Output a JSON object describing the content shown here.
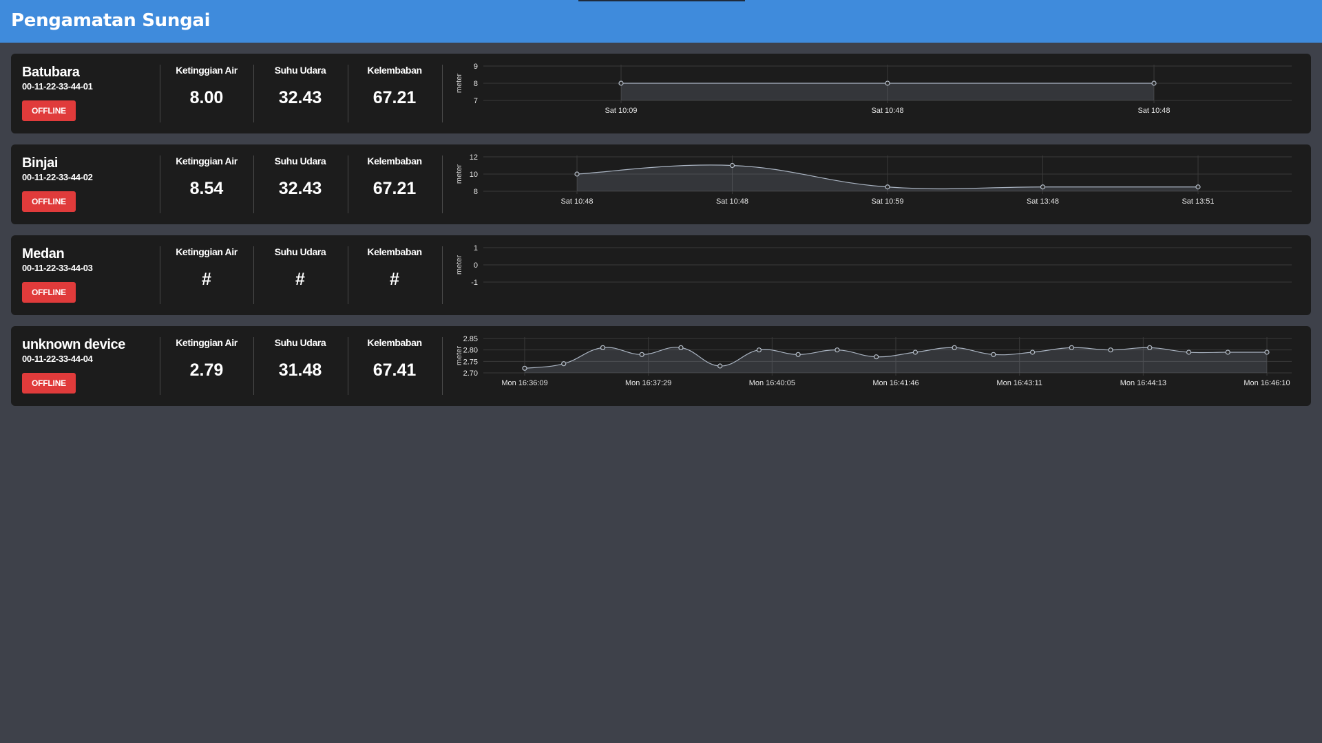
{
  "header": {
    "title": "Pengamatan Sungai"
  },
  "metric_labels": {
    "water": "Ketinggian Air",
    "temp": "Suhu Udara",
    "humidity": "Kelembaban"
  },
  "colors": {
    "accent": "#3f8bdc",
    "offline": "#e03b3b",
    "card": "#1c1c1c",
    "background": "#3e414a"
  },
  "devices": [
    {
      "name": "Batubara",
      "id": "00-11-22-33-44-01",
      "status": "OFFLINE",
      "water": "8.00",
      "temp": "32.43",
      "humidity": "67.21",
      "chart_data": {
        "type": "area",
        "ylabel": "meter",
        "x": [
          "Sat 10:09",
          "Sat 10:48",
          "Sat 10:48"
        ],
        "values": [
          8,
          8,
          8
        ],
        "ylim": [
          7,
          9
        ],
        "yticks": [
          "9",
          "8",
          "7"
        ],
        "grid": true
      }
    },
    {
      "name": "Binjai",
      "id": "00-11-22-33-44-02",
      "status": "OFFLINE",
      "water": "8.54",
      "temp": "32.43",
      "humidity": "67.21",
      "chart_data": {
        "type": "area",
        "ylabel": "meter",
        "x": [
          "Sat 10:48",
          "Sat 10:48",
          "Sat 10:59",
          "Sat 13:48",
          "Sat 13:51"
        ],
        "values": [
          10.0,
          11.0,
          8.5,
          8.5,
          8.5
        ],
        "ylim": [
          8,
          12
        ],
        "yticks": [
          "12",
          "10",
          "8"
        ],
        "grid": true
      }
    },
    {
      "name": "Medan",
      "id": "00-11-22-33-44-03",
      "status": "OFFLINE",
      "water": "#",
      "temp": "#",
      "humidity": "#",
      "chart_data": {
        "type": "area",
        "ylabel": "meter",
        "x": [],
        "values": [],
        "ylim": [
          -1,
          1
        ],
        "yticks": [
          "1",
          "0",
          "-1"
        ],
        "grid": true
      }
    },
    {
      "name": "unknown device",
      "id": "00-11-22-33-44-04",
      "status": "OFFLINE",
      "water": "2.79",
      "temp": "31.48",
      "humidity": "67.41",
      "chart_data": {
        "type": "area",
        "ylabel": "meter",
        "x_tick_labels": [
          "Mon 16:36:09",
          "Mon 16:37:29",
          "Mon 16:40:05",
          "Mon 16:41:46",
          "Mon 16:43:11",
          "Mon 16:44:13",
          "Mon 16:46:10"
        ],
        "values": [
          2.72,
          2.74,
          2.81,
          2.78,
          2.81,
          2.73,
          2.8,
          2.78,
          2.8,
          2.77,
          2.79,
          2.81,
          2.78,
          2.79,
          2.81,
          2.8,
          2.81,
          2.79,
          2.79,
          2.79
        ],
        "ylim": [
          2.7,
          2.85
        ],
        "yticks": [
          "2.85",
          "2.80",
          "2.75",
          "2.70"
        ],
        "grid": true
      }
    }
  ]
}
